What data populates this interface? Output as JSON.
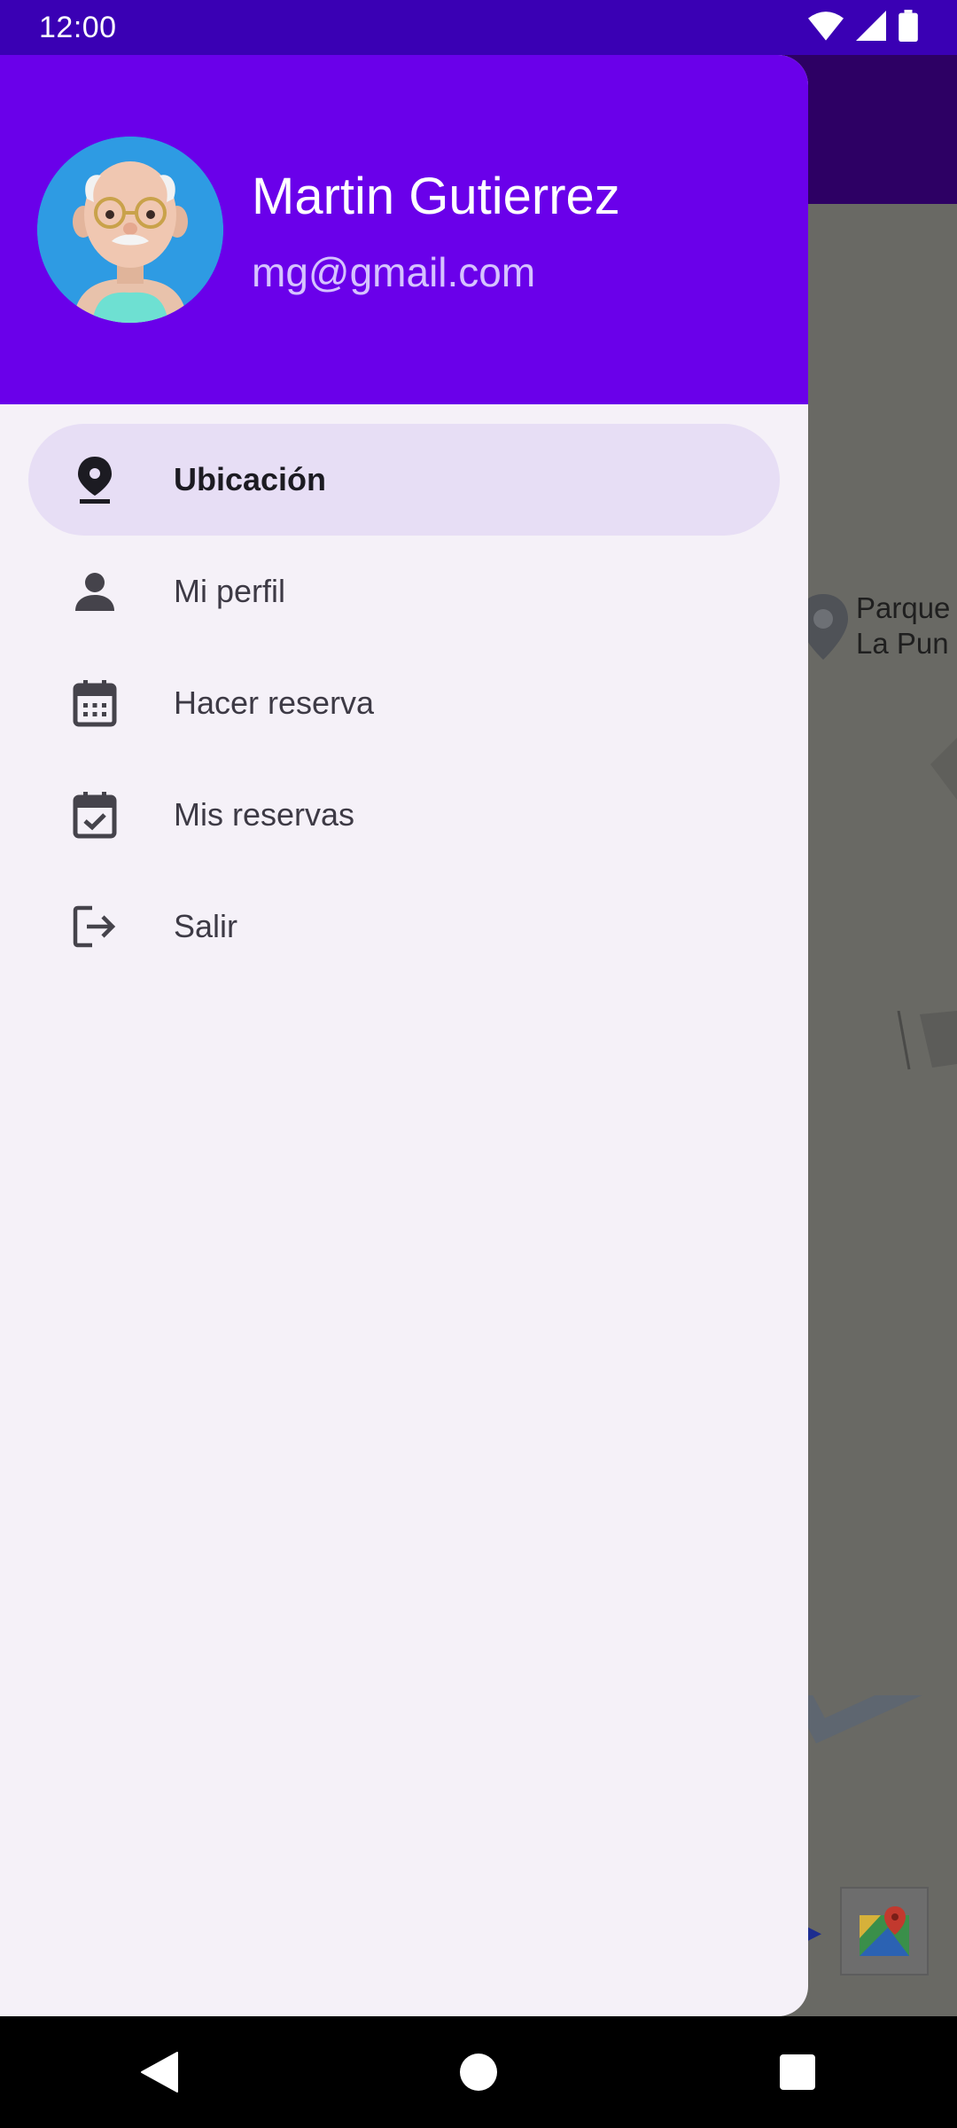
{
  "status_bar": {
    "time": "12:00",
    "icons": [
      "wifi-icon",
      "signal-icon",
      "battery-icon"
    ]
  },
  "background_app": {
    "map_place_label": "Parque\nLa Pun"
  },
  "drawer": {
    "header": {
      "user_name": "Martin Gutierrez",
      "user_email": "mg@gmail.com"
    },
    "menu": [
      {
        "label": "Ubicación",
        "icon": "location-pin-icon",
        "active": true
      },
      {
        "label": "Mi perfil",
        "icon": "person-icon",
        "active": false
      },
      {
        "label": "Hacer reserva",
        "icon": "calendar-icon",
        "active": false
      },
      {
        "label": "Mis reservas",
        "icon": "calendar-check-icon",
        "active": false
      },
      {
        "label": "Salir",
        "icon": "logout-icon",
        "active": false
      }
    ]
  },
  "nav_bar": {
    "buttons": [
      "back-icon",
      "home-icon",
      "recents-icon"
    ]
  },
  "colors": {
    "header": "#6a00ea",
    "status_bar": "#3a00b4",
    "drawer_bg": "#f5f1f8",
    "active_item": "#e7def5"
  }
}
